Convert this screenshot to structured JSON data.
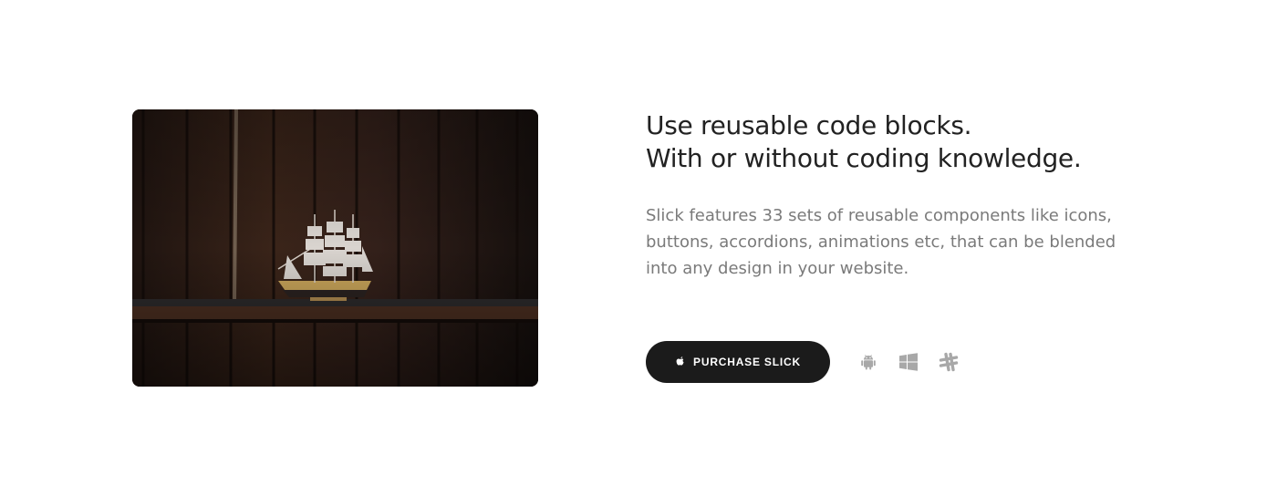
{
  "feature": {
    "headline_line1": "Use reusable code blocks.",
    "headline_line2": "With or without coding knowledge.",
    "description": "Slick features 33 sets of reusable components like icons, buttons, accordions, animations etc, that can be blended into any design in your website.",
    "purchase_button": {
      "label": "PURCHASE SLICK",
      "icon": "apple-icon"
    },
    "platform_icons": [
      "android-icon",
      "windows-icon",
      "slack-icon"
    ],
    "image": {
      "subject": "ship-model-on-wooden-shelf"
    }
  },
  "colors": {
    "button_bg": "#1b1b1b",
    "button_text": "#ffffff",
    "headline": "#222222",
    "body": "#7a7a7a",
    "icon_gray": "#a8a8a8"
  }
}
